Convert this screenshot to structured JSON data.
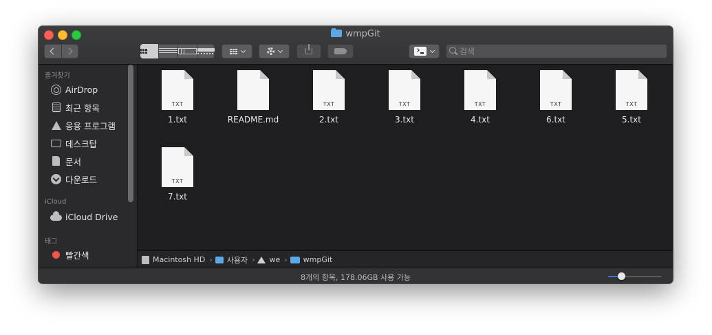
{
  "window": {
    "title": "wmpGit"
  },
  "toolbar": {
    "search_placeholder": "검색"
  },
  "sidebar": {
    "sections": [
      {
        "heading": "즐겨찾기",
        "items": [
          {
            "label": "AirDrop",
            "icon": "airdrop-icon"
          },
          {
            "label": "최근 항목",
            "icon": "recents-icon"
          },
          {
            "label": "응용 프로그램",
            "icon": "applications-icon"
          },
          {
            "label": "데스크탑",
            "icon": "desktop-icon"
          },
          {
            "label": "문서",
            "icon": "documents-icon"
          },
          {
            "label": "다운로드",
            "icon": "downloads-icon"
          }
        ]
      },
      {
        "heading": "iCloud",
        "items": [
          {
            "label": "iCloud Drive",
            "icon": "cloud-icon"
          }
        ]
      },
      {
        "heading": "태그",
        "items": [
          {
            "label": "빨간색",
            "icon": "red-tag-icon",
            "color": "#f0544f"
          }
        ]
      }
    ]
  },
  "files": [
    {
      "name": "1.txt",
      "ext": "TXT"
    },
    {
      "name": "README.md",
      "ext": ""
    },
    {
      "name": "2.txt",
      "ext": "TXT"
    },
    {
      "name": "3.txt",
      "ext": "TXT"
    },
    {
      "name": "4.txt",
      "ext": "TXT"
    },
    {
      "name": "6.txt",
      "ext": "TXT"
    },
    {
      "name": "5.txt",
      "ext": "TXT"
    },
    {
      "name": "7.txt",
      "ext": "TXT"
    }
  ],
  "pathbar": [
    {
      "label": "Macintosh HD",
      "icon": "hard-drive-icon"
    },
    {
      "label": "사용자",
      "icon": "users-folder-icon"
    },
    {
      "label": "we",
      "icon": "home-icon"
    },
    {
      "label": "wmpGit",
      "icon": "folder-icon"
    }
  ],
  "status": {
    "text": "8개의 항목, 178.06GB 사용 가능",
    "zoom_level": 0.25
  },
  "colors": {
    "accent": "#2f7de1",
    "folder": "#5aa9e6"
  }
}
